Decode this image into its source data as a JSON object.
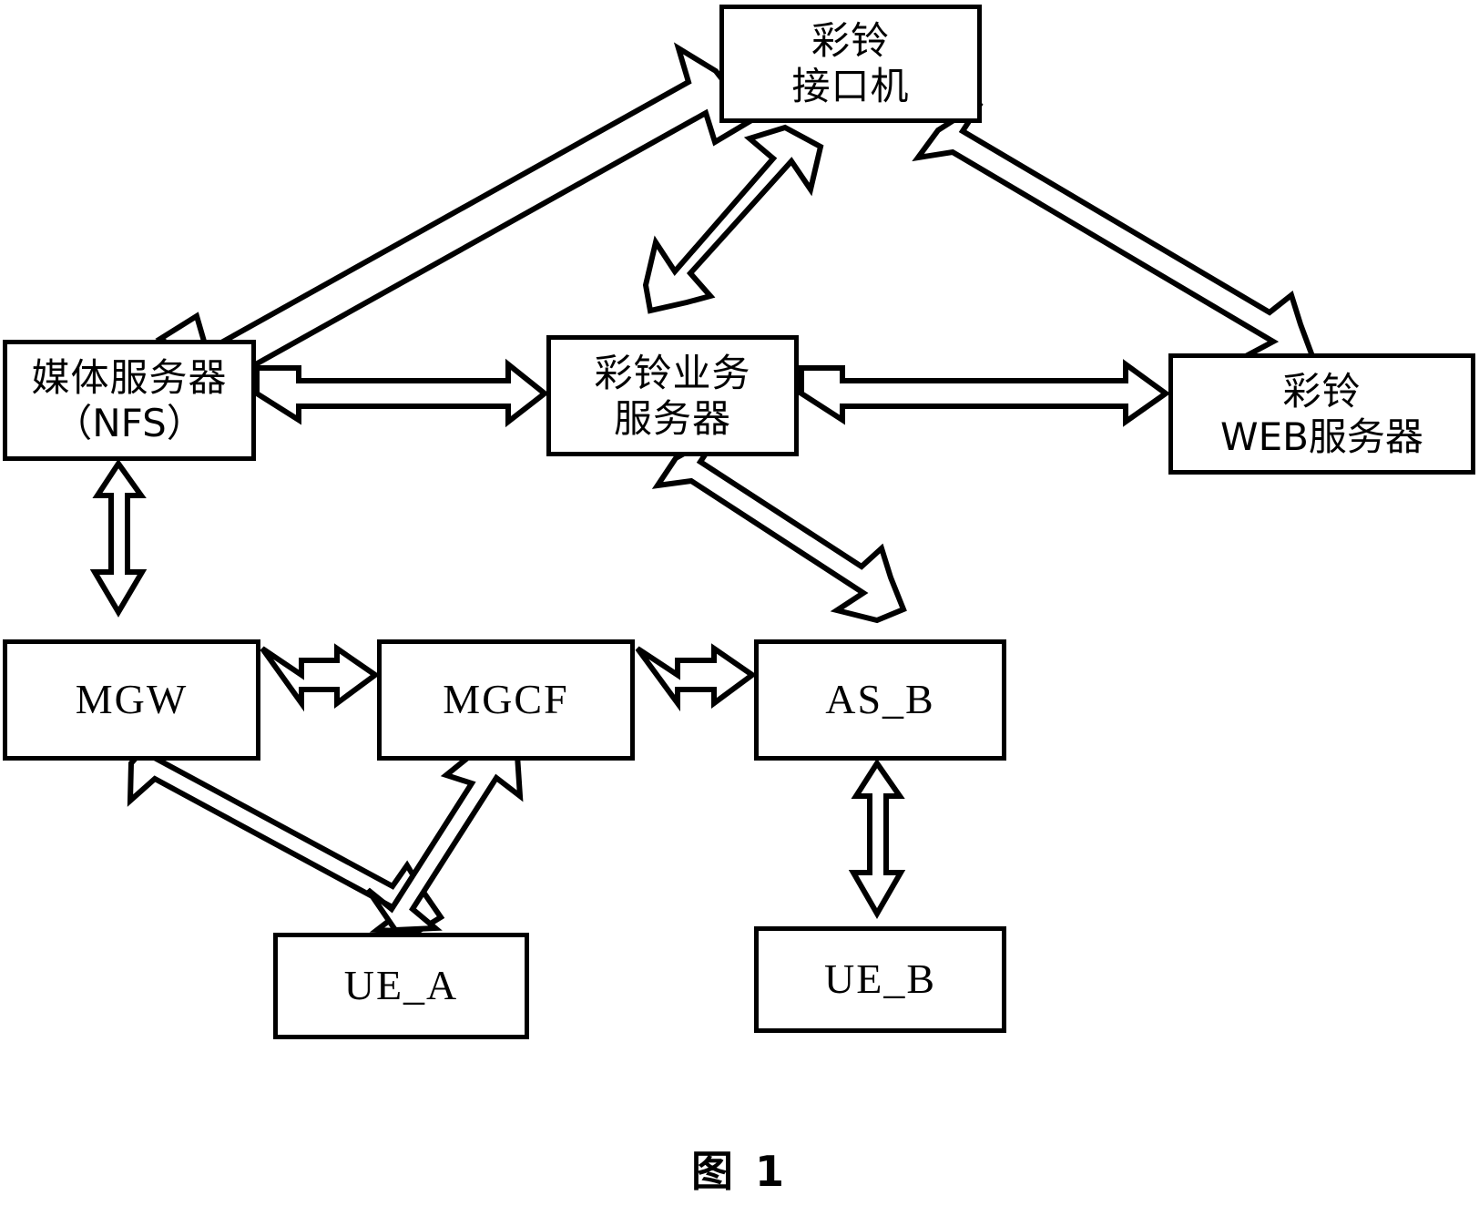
{
  "figure": {
    "caption": "图 1",
    "background_color": "#ffffff",
    "line_color": "#000000"
  },
  "nodes": {
    "crbt_interface": {
      "line1": "彩铃",
      "line2": "接口机"
    },
    "media_server": {
      "line1": "媒体服务器",
      "line2": "（NFS）"
    },
    "crbt_service": {
      "line1": "彩铃业务",
      "line2": "服务器"
    },
    "crbt_web": {
      "line1": "彩铃",
      "line2": "WEB服务器"
    },
    "mgw": {
      "label": "MGW"
    },
    "mgcf": {
      "label": "MGCF"
    },
    "as_b": {
      "label": "AS_B"
    },
    "ue_a": {
      "label": "UE_A"
    },
    "ue_b": {
      "label": "UE_B"
    }
  },
  "connections": [
    {
      "id": "interface-media",
      "from": "crbt_interface",
      "to": "media_server",
      "style": "double-headed-block-arrow",
      "orientation": "diagonal"
    },
    {
      "id": "interface-service",
      "from": "crbt_interface",
      "to": "crbt_service",
      "style": "double-headed-block-arrow",
      "orientation": "diagonal"
    },
    {
      "id": "interface-web",
      "from": "crbt_interface",
      "to": "crbt_web",
      "style": "double-headed-block-arrow",
      "orientation": "diagonal"
    },
    {
      "id": "media-service",
      "from": "media_server",
      "to": "crbt_service",
      "style": "double-headed-block-arrow",
      "orientation": "horizontal"
    },
    {
      "id": "service-web",
      "from": "crbt_service",
      "to": "crbt_web",
      "style": "double-headed-block-arrow",
      "orientation": "horizontal"
    },
    {
      "id": "media-mgw",
      "from": "media_server",
      "to": "mgw",
      "style": "double-headed-block-arrow",
      "orientation": "vertical"
    },
    {
      "id": "service-asb",
      "from": "crbt_service",
      "to": "as_b",
      "style": "double-headed-block-arrow",
      "orientation": "diagonal"
    },
    {
      "id": "mgw-mgcf",
      "from": "mgw",
      "to": "mgcf",
      "style": "double-headed-block-arrow",
      "orientation": "horizontal"
    },
    {
      "id": "mgcf-asb",
      "from": "mgcf",
      "to": "as_b",
      "style": "double-headed-block-arrow",
      "orientation": "horizontal"
    },
    {
      "id": "mgw-uea",
      "from": "mgw",
      "to": "ue_a",
      "style": "double-headed-block-arrow",
      "orientation": "diagonal"
    },
    {
      "id": "uea-mgcf",
      "from": "ue_a",
      "to": "mgcf",
      "style": "double-headed-block-arrow",
      "orientation": "diagonal"
    },
    {
      "id": "asb-ueb",
      "from": "as_b",
      "to": "ue_b",
      "style": "double-headed-block-arrow",
      "orientation": "vertical"
    }
  ]
}
